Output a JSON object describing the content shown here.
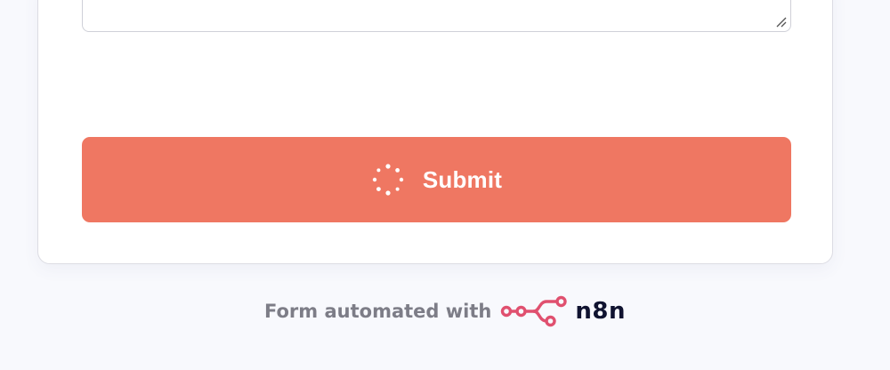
{
  "form": {
    "submit_label": "Submit",
    "submit_state": "loading"
  },
  "footer": {
    "text": "Form automated with",
    "brand": "n8n",
    "brand_icon": "n8n-logo-icon"
  },
  "colors": {
    "accent": "#ef7762",
    "brand_logo": "#e0506f",
    "brand_text": "#101330",
    "footer_text": "#7d7d87",
    "background": "#f8f9fd"
  }
}
